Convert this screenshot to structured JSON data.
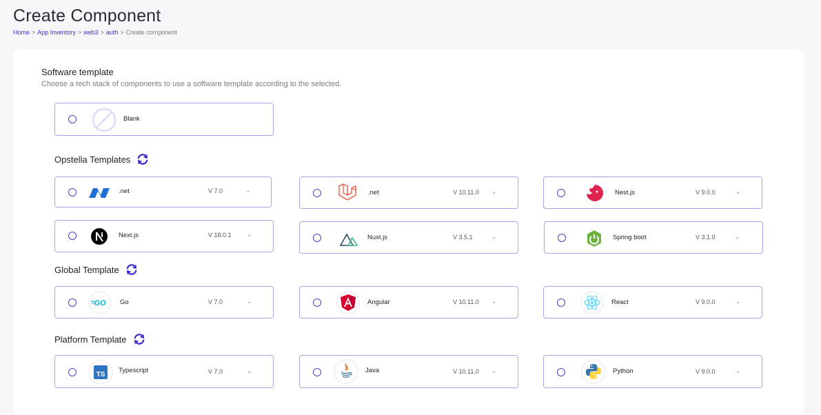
{
  "page": {
    "title": "Create Component",
    "breadcrumb": [
      "Home",
      "App Inventory",
      "web3",
      "auth",
      "Create component"
    ]
  },
  "software": {
    "title": "Software template",
    "description": "Choose a tech stack of components to use a software template according to the selected.",
    "blank_label": "Blank"
  },
  "groups": [
    {
      "title": "Opstella Templates",
      "cards": [
        {
          "name": ".net",
          "version": "V 7.0",
          "icon": "dotnet-icon"
        },
        {
          "name": ".net",
          "version": "V 10.11.0",
          "icon": "laravel-icon"
        },
        {
          "name": "Nest.js",
          "version": "V 9.0.0",
          "icon": "nestjs-icon"
        },
        {
          "name": "Next.js",
          "version": "V 18.0.1",
          "icon": "nextjs-icon"
        },
        {
          "name": "Nuxt.js",
          "version": "V 3.5.1",
          "icon": "nuxtjs-icon"
        },
        {
          "name": "Spring boot",
          "version": "V 3.1.0",
          "icon": "springboot-icon"
        }
      ]
    },
    {
      "title": "Global Template",
      "cards": [
        {
          "name": "Go",
          "version": "V 7.0",
          "icon": "go-icon"
        },
        {
          "name": "Angular",
          "version": "V 10.11.0",
          "icon": "angular-icon"
        },
        {
          "name": "React",
          "version": "V 9.0.0",
          "icon": "react-icon"
        }
      ]
    },
    {
      "title": "Platform Template",
      "cards": [
        {
          "name": "Typescript",
          "version": "V 7.0",
          "icon": "typescript-icon"
        },
        {
          "name": "Java",
          "version": "V 10.11.0",
          "icon": "java-icon"
        },
        {
          "name": "Python",
          "version": "V 9.0.0",
          "icon": "python-icon"
        }
      ]
    }
  ],
  "colors": {
    "accent": "#3b2fc9",
    "card_border": "#a9a3e6"
  }
}
